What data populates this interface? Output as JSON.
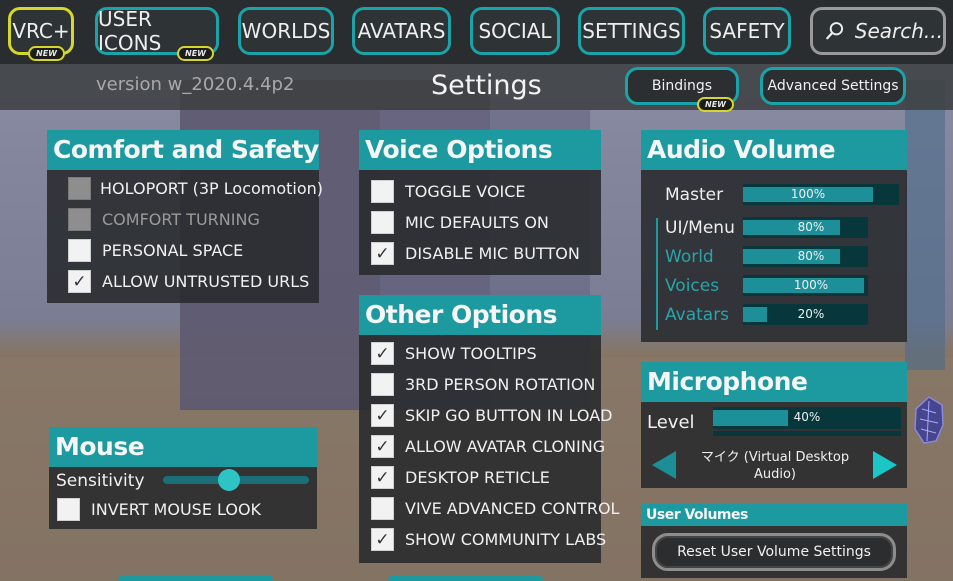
{
  "nav": {
    "vrc_plus": "VRC+",
    "user_icons": "USER ICONS",
    "worlds": "WORLDS",
    "avatars": "AVATARS",
    "social": "SOCIAL",
    "settings": "SETTINGS",
    "safety": "SAFETY",
    "search_placeholder": "Search...",
    "new_badge": "NEW"
  },
  "header": {
    "version": "version w_2020.4.4p2",
    "title": "Settings",
    "bindings": "Bindings",
    "advanced_settings": "Advanced Settings"
  },
  "comfort_safety": {
    "title": "Comfort and Safety",
    "items": [
      {
        "label": "HOLOPORT (3P Locomotion)",
        "checked": false,
        "disabled": true
      },
      {
        "label": "COMFORT TURNING",
        "checked": false,
        "disabled": true
      },
      {
        "label": "PERSONAL SPACE",
        "checked": false,
        "disabled": false
      },
      {
        "label": "ALLOW UNTRUSTED URLS",
        "checked": true,
        "disabled": false
      }
    ]
  },
  "voice_options": {
    "title": "Voice Options",
    "items": [
      {
        "label": "TOGGLE VOICE",
        "checked": false
      },
      {
        "label": "MIC DEFAULTS ON",
        "checked": false
      },
      {
        "label": "DISABLE MIC BUTTON",
        "checked": true
      }
    ]
  },
  "other_options": {
    "title": "Other Options",
    "items": [
      {
        "label": "SHOW TOOLTIPS",
        "checked": true
      },
      {
        "label": "3RD PERSON ROTATION",
        "checked": false
      },
      {
        "label": "SKIP GO BUTTON IN LOAD",
        "checked": true
      },
      {
        "label": "ALLOW AVATAR CLONING",
        "checked": true
      },
      {
        "label": "DESKTOP RETICLE",
        "checked": true
      },
      {
        "label": "VIVE ADVANCED CONTROL",
        "checked": false
      },
      {
        "label": "SHOW COMMUNITY LABS",
        "checked": true
      }
    ]
  },
  "audio_volume": {
    "title": "Audio Volume",
    "channels": [
      {
        "label": "Master",
        "value": 100,
        "text": "100%"
      },
      {
        "label": "UI/Menu",
        "value": 80,
        "text": "80%"
      },
      {
        "label": "World",
        "value": 80,
        "text": "80%"
      },
      {
        "label": "Voices",
        "value": 100,
        "text": "100%"
      },
      {
        "label": "Avatars",
        "value": 20,
        "text": "20%"
      }
    ]
  },
  "mouse": {
    "title": "Mouse",
    "sensitivity_label": "Sensitivity",
    "sensitivity_value": 0.45,
    "invert_label": "INVERT MOUSE LOOK",
    "invert_checked": false
  },
  "microphone": {
    "title": "Microphone",
    "level_label": "Level",
    "level_value": 40,
    "level_text": "40%",
    "device": "マイク (Virtual Desktop Audio)"
  },
  "user_volumes": {
    "title": "User Volumes",
    "reset_label": "Reset User Volume Settings"
  },
  "colors": {
    "accent": "#1d9aa0",
    "vrc_plus": "#d6d62c",
    "panel_bg": "#2a2c2e"
  }
}
